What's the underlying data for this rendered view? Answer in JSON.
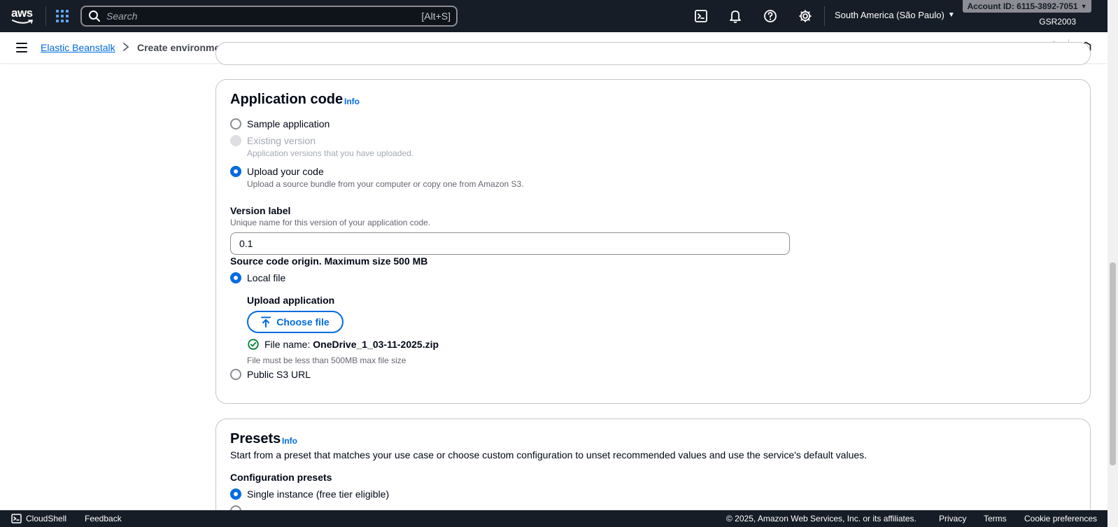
{
  "topnav": {
    "logo_text": "aws",
    "search_placeholder": "Search",
    "search_shortcut": "[Alt+S]",
    "region": "South America (São Paulo)",
    "account": "Account ID: 6115-3892-7051",
    "user": "GSR2003"
  },
  "breadcrumb": {
    "parent": "Elastic Beanstalk",
    "current": "Create environment"
  },
  "application_code": {
    "title": "Application code",
    "info": "Info",
    "options": [
      {
        "label": "Sample application",
        "description": "",
        "state": "unchecked"
      },
      {
        "label": "Existing version",
        "description": "Application versions that you have uploaded.",
        "state": "disabled"
      },
      {
        "label": "Upload your code",
        "description": "Upload a source bundle from your computer or copy one from Amazon S3.",
        "state": "checked"
      }
    ],
    "version_label": {
      "label": "Version label",
      "description": "Unique name for this version of your application code.",
      "value": "0.1"
    },
    "source_origin": {
      "label": "Source code origin. Maximum size 500 MB",
      "local_file": "Local file",
      "upload_label": "Upload application",
      "choose_file": "Choose file",
      "file_name_prefix": "File name:",
      "file_name": "OneDrive_1_03-11-2025.zip",
      "file_constraint": "File must be less than 500MB max file size",
      "public_s3": "Public S3 URL"
    }
  },
  "presets": {
    "title": "Presets",
    "info": "Info",
    "description": "Start from a preset that matches your use case or choose custom configuration to unset recommended values and use the service's default values.",
    "config_label": "Configuration presets",
    "option_selected": "Single instance (free tier eligible)"
  },
  "footer": {
    "cloudshell": "CloudShell",
    "feedback": "Feedback",
    "copyright": "© 2025, Amazon Web Services, Inc. or its affiliates.",
    "privacy": "Privacy",
    "terms": "Terms",
    "cookies": "Cookie preferences"
  },
  "colors": {
    "nav_bg": "#161d26",
    "link": "#006ce0",
    "success": "#00802f"
  }
}
